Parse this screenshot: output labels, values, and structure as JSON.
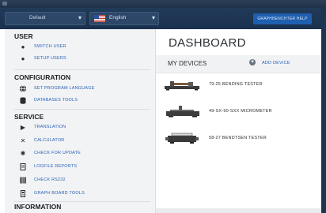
{
  "toolbar": {
    "user_select_value": "Default",
    "language_select_value": "English",
    "help_button_label": "GRAPHBENCHTER HELP"
  },
  "sidebar": {
    "user": {
      "heading": "USER",
      "items": [
        {
          "label": "SWITCH USER",
          "icon": "user-icon"
        },
        {
          "label": "SETUP USERS",
          "icon": "users-icon"
        }
      ]
    },
    "configuration": {
      "heading": "CONFIGURATION",
      "items": [
        {
          "label": "SET PROGRAM LANGUAGE",
          "icon": "globe-icon"
        },
        {
          "label": "DATABASES TOOLS",
          "icon": "database-icon"
        }
      ]
    },
    "service": {
      "heading": "SERVICE",
      "items": [
        {
          "label": "TRANSLATION",
          "icon": "play-icon"
        },
        {
          "label": "CALCULATOR",
          "icon": "calculator-icon"
        },
        {
          "label": "CHECK FOR UPDATE",
          "icon": "gear-icon"
        },
        {
          "label": "LOGFILE REPORTS",
          "icon": "document-icon"
        },
        {
          "label": "CHECK RS232",
          "icon": "port-icon"
        },
        {
          "label": "GRAPH BOARD TOOLS",
          "icon": "board-icon"
        }
      ]
    },
    "information": {
      "heading": "INFORMATION"
    }
  },
  "main": {
    "title": "DASHBOARD",
    "devices_label": "MY DEVICES",
    "add_device_label": "ADD DEVICE",
    "devices": [
      {
        "label": "79-25 BENDING TESTER",
        "icon": "bending-tester-icon"
      },
      {
        "label": "49-SX-90-SXX MICROMETER",
        "icon": "micrometer-icon"
      },
      {
        "label": "58-27 BENDTSEN TESTER",
        "icon": "bendtsen-tester-icon"
      }
    ]
  },
  "colors": {
    "toolbar_bg": "#1b3150",
    "link_blue": "#2a62b5",
    "help_button": "#1e5fb0",
    "sidebar_bg": "#f2f3f5"
  }
}
